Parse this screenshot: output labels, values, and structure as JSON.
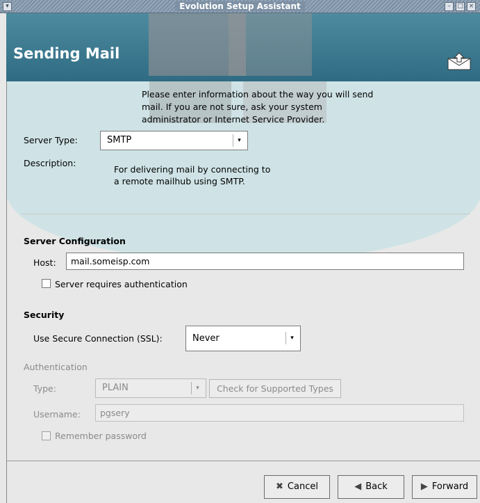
{
  "window": {
    "title": "Evolution Setup Assistant"
  },
  "header": {
    "title": "Sending Mail"
  },
  "intro": "Please enter information about the way you will send mail. If you are not sure, ask your system administrator or Internet Service Provider.",
  "server_type": {
    "label": "Server Type:",
    "value": "SMTP"
  },
  "description": {
    "label": "Description:",
    "text": "For delivering mail by connecting to a remote mailhub using SMTP."
  },
  "server_config": {
    "title": "Server Configuration",
    "host_label": "Host:",
    "host_value": "mail.someisp.com",
    "auth_required_label": "Server requires authentication",
    "auth_required_checked": false
  },
  "security": {
    "title": "Security",
    "ssl_label": "Use Secure Connection (SSL):",
    "ssl_value": "Never"
  },
  "authentication": {
    "title": "Authentication",
    "type_label": "Type:",
    "type_value": "PLAIN",
    "check_button": "Check for Supported Types",
    "username_label": "Username:",
    "username_value": "pgsery",
    "remember_label": "Remember password",
    "remember_checked": false
  },
  "buttons": {
    "cancel": "Cancel",
    "back": "Back",
    "forward": "Forward"
  }
}
